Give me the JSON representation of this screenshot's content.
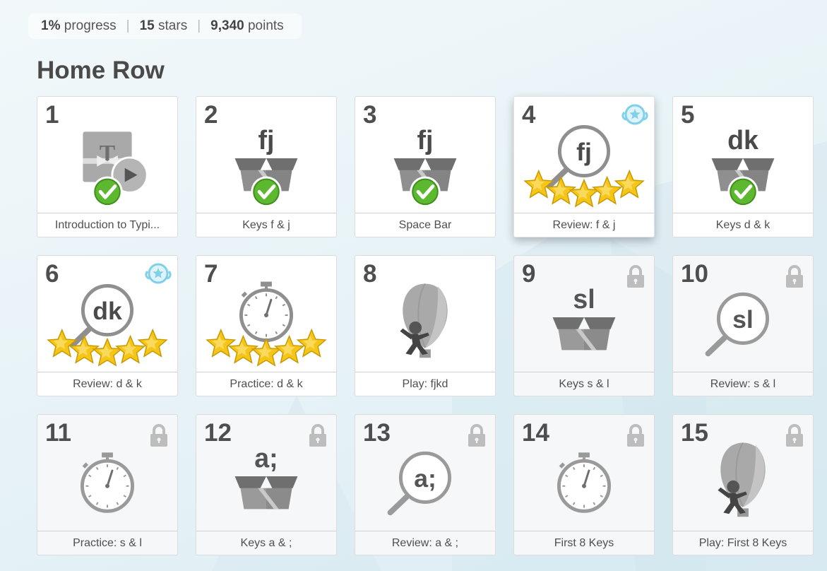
{
  "stats": {
    "progress_value": "1%",
    "progress_label": "progress",
    "stars_value": "15",
    "stars_label": "stars",
    "points_value": "9,340",
    "points_label": "points",
    "separator": "|"
  },
  "section": {
    "title": "Home Row"
  },
  "colors": {
    "check_green": "#5cb82e",
    "star_gold": "#f5c518",
    "badge_blue": "#7fd0e8",
    "lock_gray": "#bdbdbd",
    "icon_gray": "#8f8f8f"
  },
  "lessons": [
    {
      "number": "1",
      "label": "Introduction to Typi...",
      "icon": "video-lesson-icon",
      "status": "completed",
      "stars": 0,
      "badge": false,
      "locked": false
    },
    {
      "number": "2",
      "label": "Keys f & j",
      "icon": "box-icon",
      "keys": "fj",
      "status": "completed",
      "stars": 0,
      "badge": false,
      "locked": false
    },
    {
      "number": "3",
      "label": "Space Bar",
      "icon": "box-icon",
      "keys": "fj",
      "status": "completed",
      "stars": 0,
      "badge": false,
      "locked": false
    },
    {
      "number": "4",
      "label": "Review: f & j",
      "icon": "magnifier-icon",
      "keys": "fj",
      "status": "starred",
      "stars": 5,
      "badge": true,
      "locked": false
    },
    {
      "number": "5",
      "label": "Keys d & k",
      "icon": "box-icon",
      "keys": "dk",
      "status": "completed",
      "stars": 0,
      "badge": false,
      "locked": false
    },
    {
      "number": "6",
      "label": "Review: d & k",
      "icon": "magnifier-icon",
      "keys": "dk",
      "status": "starred",
      "stars": 5,
      "badge": true,
      "locked": false
    },
    {
      "number": "7",
      "label": "Practice: d & k",
      "icon": "stopwatch-icon",
      "status": "starred",
      "stars": 5,
      "badge": false,
      "locked": false
    },
    {
      "number": "8",
      "label": "Play: fjkd",
      "icon": "balloon-ninja-icon",
      "status": "available",
      "stars": 0,
      "badge": false,
      "locked": false
    },
    {
      "number": "9",
      "label": "Keys s & l",
      "icon": "box-icon",
      "keys": "sl",
      "status": "locked",
      "stars": 0,
      "badge": false,
      "locked": true
    },
    {
      "number": "10",
      "label": "Review: s & l",
      "icon": "magnifier-icon",
      "keys": "sl",
      "status": "locked",
      "stars": 0,
      "badge": false,
      "locked": true
    },
    {
      "number": "11",
      "label": "Practice: s & l",
      "icon": "stopwatch-icon",
      "status": "locked",
      "stars": 0,
      "badge": false,
      "locked": true
    },
    {
      "number": "12",
      "label": "Keys a & ;",
      "icon": "box-icon",
      "keys": "a;",
      "status": "locked",
      "stars": 0,
      "badge": false,
      "locked": true
    },
    {
      "number": "13",
      "label": "Review: a & ;",
      "icon": "magnifier-icon",
      "keys": "a;",
      "status": "locked",
      "stars": 0,
      "badge": false,
      "locked": true
    },
    {
      "number": "14",
      "label": "First 8 Keys",
      "icon": "stopwatch-icon",
      "status": "locked",
      "stars": 0,
      "badge": false,
      "locked": true
    },
    {
      "number": "15",
      "label": "Play: First 8 Keys",
      "icon": "balloon-ninja-icon",
      "status": "locked",
      "stars": 0,
      "badge": false,
      "locked": true
    }
  ]
}
